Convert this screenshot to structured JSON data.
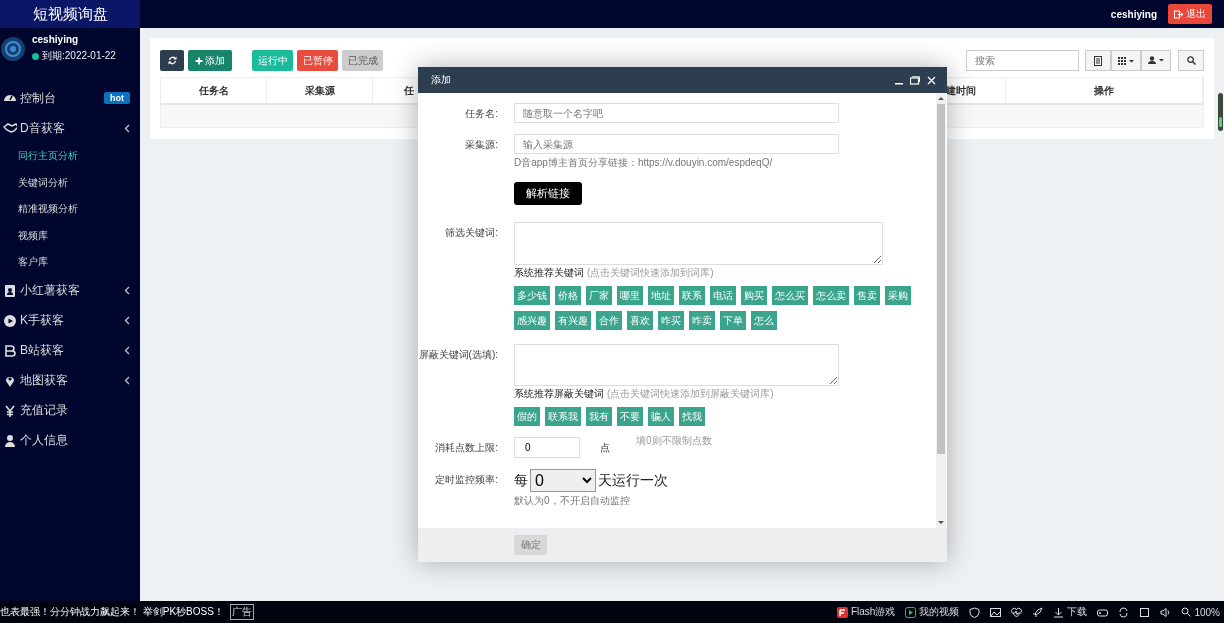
{
  "app": {
    "title": "短视频询盘"
  },
  "header": {
    "user": "ceshiying",
    "logout": "退出"
  },
  "profile": {
    "name": "ceshiying",
    "online": true,
    "expiry": "到期:2022-01-22"
  },
  "sidebar": {
    "items": [
      {
        "kind": "link",
        "label": "控制台",
        "badge": "hot"
      },
      {
        "kind": "group",
        "label": "D音获客",
        "expanded": true,
        "children": [
          {
            "label": "同行主页分析",
            "selected": true
          },
          {
            "label": "关键词分析",
            "selected": false
          },
          {
            "label": "精准视频分析",
            "selected": false
          },
          {
            "label": "视频库",
            "selected": false
          },
          {
            "label": "客户库",
            "selected": false
          }
        ]
      },
      {
        "kind": "group",
        "label": "小红薯获客",
        "expanded": false
      },
      {
        "kind": "group",
        "label": "K手获客",
        "expanded": false
      },
      {
        "kind": "group",
        "label": "B站获客",
        "expanded": false
      },
      {
        "kind": "group",
        "label": "地图获客",
        "expanded": false
      },
      {
        "kind": "link",
        "label": "充值记录"
      },
      {
        "kind": "link",
        "label": "个人信息"
      }
    ]
  },
  "toolbar": {
    "add": "添加",
    "filters": [
      {
        "label": "运行中",
        "color": "#1abc9c",
        "disabled": false
      },
      {
        "label": "已暂停",
        "color": "#e74c3c",
        "disabled": false
      },
      {
        "label": "已完成",
        "color": "#cccccc",
        "disabled": true
      }
    ],
    "search": {
      "placeholder": "搜索"
    }
  },
  "table": {
    "columns": [
      "任务名",
      "采集源",
      "任",
      "建时间",
      "操作"
    ]
  },
  "modal": {
    "title": "添加",
    "fields": [
      {
        "kind": "input",
        "label": "任务名:",
        "placeholder": "随意取一个名字吧"
      },
      {
        "kind": "input",
        "label": "采集源:",
        "placeholder": "输入采集源",
        "help": "D音app博主首页分享链接：https://v.douyin.com/espdeqQ/",
        "action": "解析链接"
      },
      {
        "kind": "textarea",
        "label": "筛选关键词:",
        "suggest_title": "系统推荐关键词",
        "suggest_hint": "(点击关键词快速添加到词库)",
        "tags": [
          "多少钱",
          "价格",
          "厂家",
          "哪里",
          "地址",
          "联系",
          "电话",
          "购买",
          "怎么买",
          "怎么卖",
          "售卖",
          "采购",
          "感兴趣",
          "有兴趣",
          "合作",
          "喜欢",
          "咋买",
          "咋卖",
          "下单",
          "怎么"
        ]
      },
      {
        "kind": "textarea",
        "label": "屏蔽关键词(选填):",
        "suggest_title": "系统推荐屏蔽关键词",
        "suggest_hint": "(点击关键词快速添加到屏蔽关键词库)",
        "tags": [
          "假的",
          "联系我",
          "我有",
          "不要",
          "骗人",
          "找我"
        ]
      },
      {
        "kind": "points",
        "label": "消耗点数上限:",
        "value": "0",
        "unit": "点",
        "hint": "填0则不限制点数"
      },
      {
        "kind": "schedule",
        "label": "定时监控频率:",
        "prefix": "每",
        "value": "0",
        "suffix": "天运行一次",
        "help": "默认为0，不开启自动监控"
      }
    ],
    "confirm": {
      "label": "确定",
      "disabled": true
    }
  },
  "status_bar": {
    "ad_text": "也表最强！分分钟战力飙起来！ 举剑PK秒BOSS！",
    "ad_tag": "广告",
    "flash": "Flash游戏",
    "video": "我的视频",
    "download": "下载",
    "zoom": "100%"
  }
}
